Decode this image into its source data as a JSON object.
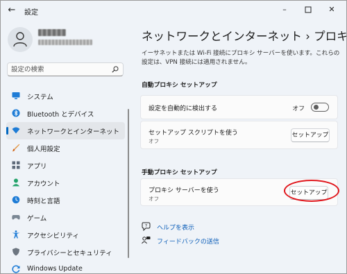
{
  "window": {
    "title": "設定",
    "back_icon": "arrow-left-icon",
    "controls": [
      "minimize-icon",
      "maximize-icon",
      "close-icon"
    ]
  },
  "search": {
    "placeholder": "設定の検索"
  },
  "sidebar": {
    "items": [
      {
        "label": "システム",
        "icon": "monitor-icon",
        "color": "#1e7cd6"
      },
      {
        "label": "Bluetooth とデバイス",
        "icon": "bluetooth-icon",
        "color": "#1e7cd6"
      },
      {
        "label": "ネットワークとインターネット",
        "icon": "wifi-icon",
        "color": "#1e7cd6",
        "selected": true
      },
      {
        "label": "個人用設定",
        "icon": "brush-icon",
        "color": "#e08a2c"
      },
      {
        "label": "アプリ",
        "icon": "apps-icon",
        "color": "#5f6b7a"
      },
      {
        "label": "アカウント",
        "icon": "person-icon",
        "color": "#23a36b"
      },
      {
        "label": "時刻と言語",
        "icon": "clock-globe-icon",
        "color": "#1e7cd6"
      },
      {
        "label": "ゲーム",
        "icon": "gamepad-icon",
        "color": "#7a8794"
      },
      {
        "label": "アクセシビリティ",
        "icon": "accessibility-icon",
        "color": "#1e7cd6"
      },
      {
        "label": "プライバシーとセキュリティ",
        "icon": "shield-icon",
        "color": "#6d7680"
      },
      {
        "label": "Windows Update",
        "icon": "update-icon",
        "color": "#1e7cd6"
      }
    ]
  },
  "main": {
    "heading": "ネットワークとインターネット  ›  プロキシ",
    "description": "イーサネットまたは Wi-Fi 接続にプロキシ サーバーを使います。これらの設定は、VPN 接続には適用されません。",
    "auto_section": {
      "title": "自動プロキシ セットアップ",
      "detect": {
        "label": "設定を自動的に検出する",
        "toggle_state": "オフ"
      },
      "script": {
        "label": "セットアップ スクリプトを使う",
        "sub": "オフ",
        "button": "セットアップ"
      }
    },
    "manual_section": {
      "title": "手動プロキシ セットアップ",
      "server": {
        "label": "プロキシ サーバーを使う",
        "sub": "オフ",
        "button": "セットアップ"
      }
    },
    "links": [
      {
        "label": "ヘルプを表示",
        "icon": "help-icon"
      },
      {
        "label": "フィードバックの送信",
        "icon": "feedback-icon"
      }
    ]
  },
  "colors": {
    "accent": "#0067c0",
    "link": "#0b5db8",
    "highlight_oval": "#e0151b",
    "background": "#eff3f8",
    "card": "#fbfbfb"
  }
}
